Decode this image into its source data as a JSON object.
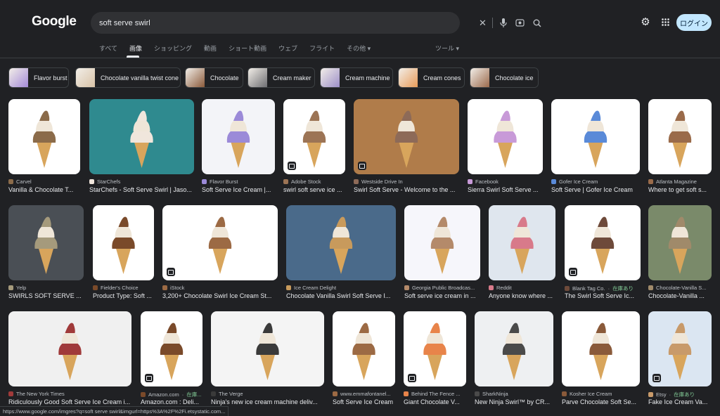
{
  "header": {
    "logo": "Google",
    "search_value": "soft serve swirl",
    "login_label": "ログイン"
  },
  "tabs": [
    "すべて",
    "画像",
    "ショッピング",
    "動画",
    "ショート動画",
    "ウェブ",
    "フライト",
    "その他 ▾"
  ],
  "active_tab": "画像",
  "tools_label": "ツール ▾",
  "chips": [
    {
      "label": "Flavor burst",
      "color": "#a48ad8"
    },
    {
      "label": "Chocolate vanilla twist cone",
      "color": "#d8c2a6"
    },
    {
      "label": "Chocolate",
      "color": "#8b5a3a"
    },
    {
      "label": "Cream maker",
      "color": "#6e6e72"
    },
    {
      "label": "Cream machine",
      "color": "#9d8fc8"
    },
    {
      "label": "Cream cones",
      "color": "#e89b59"
    },
    {
      "label": "Chocolate ice",
      "color": "#9b6a4c"
    }
  ],
  "results": [
    {
      "source": "Carvel",
      "title": "Vanilla & Chocolate T...",
      "bg": "#ffffff",
      "fg": "#8b6b4a"
    },
    {
      "source": "StarChefs",
      "title": "StarChefs - Soft Serve Swirl | Jaso...",
      "bg": "#2f8a8f",
      "fg": "#f0e6dc"
    },
    {
      "source": "Flavor Burst",
      "title": "Soft Serve Ice Cream |...",
      "bg": "#f3f4f8",
      "fg": "#9b8ad8"
    },
    {
      "source": "Adobe Stock",
      "title": "swirl soft serve ice ...",
      "bg": "#ffffff",
      "fg": "#9c7455"
    },
    {
      "source": "Westside Drive In",
      "title": "Swirl Soft Serve - Welcome to the ...",
      "bg": "#b07c4a",
      "fg": "#8d6a58"
    },
    {
      "source": "Facebook",
      "title": "Sierra Swirl Soft Serve ...",
      "bg": "#ffffff",
      "fg": "#c89ad8"
    },
    {
      "source": "Gofer Ice Cream",
      "title": "Soft Serve | Gofer Ice Cream",
      "bg": "#ffffff",
      "fg": "#5a8ad8"
    },
    {
      "source": "Atlanta Magazine",
      "title": "Where to get soft s...",
      "bg": "#ffffff",
      "fg": "#9a6b4a"
    },
    {
      "source": "Yelp",
      "title": "SWIRLS SOFT SERVE ...",
      "bg": "#4a4f55",
      "fg": "#a59a7c"
    },
    {
      "source": "Fielder's Choice",
      "title": "Product Type: Soft ...",
      "bg": "#ffffff",
      "fg": "#7a4a2a"
    },
    {
      "source": "iStock",
      "title": "3,200+ Chocolate Swirl Ice Cream St...",
      "bg": "#ffffff",
      "fg": "#9c6a44"
    },
    {
      "source": "Ice Cream Delight",
      "title": "Chocolate Vanilla Swirl Soft Serve I...",
      "bg": "#4a6a8a",
      "fg": "#c89a5c"
    },
    {
      "source": "Georgia Public Broadcas...",
      "title": "Soft serve ice cream in ...",
      "bg": "#f6f6fb",
      "fg": "#b48a6a"
    },
    {
      "source": "Reddit",
      "title": "Anyone know where ...",
      "bg": "#dfe6ee",
      "fg": "#d87a8a"
    },
    {
      "source": "Blank Tag Co.",
      "stock": "在庫あり",
      "title": "The Swirl Soft Serve Ic...",
      "bg": "#ffffff",
      "fg": "#6e4a3a"
    },
    {
      "source": "Chocolate-Vanilla S...",
      "title": "Chocolate-Vanilla ...",
      "bg": "#7a8a6a",
      "fg": "#a08a6a"
    },
    {
      "source": "The New York Times",
      "title": "Ridiculously Good Soft Serve Ice Cream i...",
      "bg": "#f0f0f0",
      "fg": "#a03a3a"
    },
    {
      "source": "Amazon.com",
      "stock": "在庫...",
      "title": "Amazon.com : Deli...",
      "bg": "#ffffff",
      "fg": "#7a4a2a"
    },
    {
      "source": "The Verge",
      "title": "Ninja's new ice cream machine deliv...",
      "bg": "#f4f4f4",
      "fg": "#3a3a3a"
    },
    {
      "source": "www.emmafontanel...",
      "title": "Soft Serve Ice Cream",
      "bg": "#ffffff",
      "fg": "#9c6a44"
    },
    {
      "source": "Behind The Fence ...",
      "title": "Giant Chocolate V...",
      "bg": "#ffffff",
      "fg": "#e8844a"
    },
    {
      "source": "SharkNinja",
      "title": "New Ninja Swirl™ by CR...",
      "bg": "#eef0f2",
      "fg": "#4a4a4a"
    },
    {
      "source": "Kosher Ice Cream",
      "title": "Parve Chocolate Soft Se...",
      "bg": "#ffffff",
      "fg": "#8a5a3a"
    },
    {
      "source": "Etsy",
      "stock": "在庫あり",
      "title": "Fake Ice Cream Va...",
      "bg": "#dbe6f2",
      "fg": "#c89a6a"
    }
  ],
  "status_url": "https://www.google.com/imgres?q=soft serve swirl&imgurl=https%3A%2F%2Fi.etsystatic.com..."
}
